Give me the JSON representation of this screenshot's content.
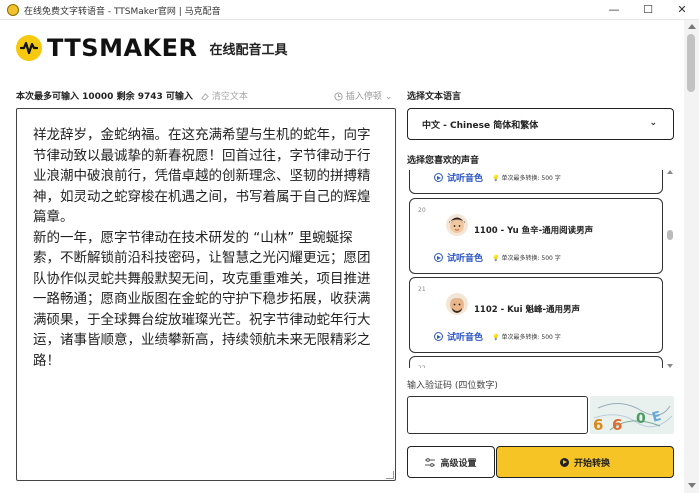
{
  "window": {
    "title": "在线免费文字转语音 - TTSMaker官网 | 马克配音",
    "minimize": "—",
    "maximize": "☐",
    "close": "✕"
  },
  "header": {
    "brand": "TTSMAKER",
    "subtitle": "在线配音工具"
  },
  "editor": {
    "limit_info": "本次最多可输入 10000 剩余 9743 可输入",
    "clear_label": "清空文本",
    "insert_pause_label": "插入停顿",
    "paragraphs": [
      "祥龙辞岁，金蛇纳福。在这充满希望与生机的蛇年，向字节律动致以最诚挚的新春祝愿！回首过往，字节律动于行业浪潮中破浪前行，凭借卓越的创新理念、坚韧的拼搏精神，如灵动之蛇穿梭在机遇之间，书写着属于自己的辉煌篇章。",
      "新的一年，愿字节律动在技术研发的 “山林” 里蜿蜒探索，不断解锁前沿科技密码，让智慧之光闪耀更远；愿团队协作似灵蛇共舞般默契无间，攻克重重难关，项目推进一路畅通；愿商业版图在金蛇的守护下稳步拓展，收获满满硕果，于全球舞台绽放璀璨光芒。祝字节律动蛇年行大运，诸事皆顺意，业绩攀新高，持续领航未来无限精彩之路！"
    ]
  },
  "language": {
    "label": "选择文本语言",
    "selected": "中文 - Chinese 简体和繁体"
  },
  "voices": {
    "label": "选择您喜欢的声音",
    "listen_label": "试听音色",
    "limit_label": "单次最多转换: 500 字",
    "items": [
      {
        "index": "",
        "name": ""
      },
      {
        "index": "20",
        "name": "1100 - Yu 鱼辛-通用阅读男声"
      },
      {
        "index": "21",
        "name": "1102 - Kui 魁峰-通用男声"
      },
      {
        "index": "22",
        "name": ""
      }
    ]
  },
  "captcha": {
    "label": "输入验证码 (四位数字)",
    "input_value": "",
    "image_text": "66 0E"
  },
  "actions": {
    "advanced_label": "高级设置",
    "convert_label": "开始转换"
  },
  "colors": {
    "brand_yellow": "#f6c424",
    "link_blue": "#2f59c7"
  }
}
